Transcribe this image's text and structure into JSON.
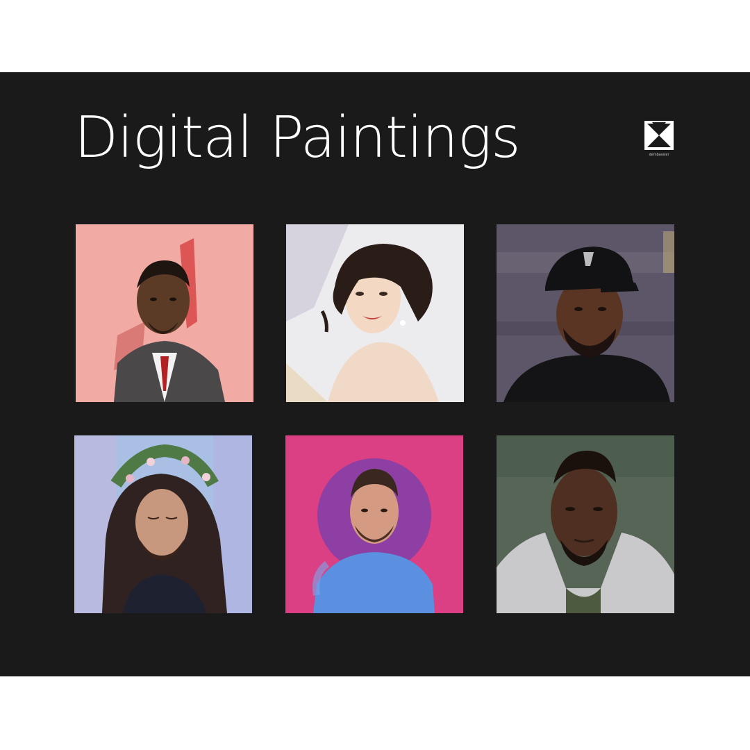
{
  "page": {
    "title": "Digital Paintings"
  },
  "brand": {
    "logo_caption": "dembassier"
  },
  "gallery": {
    "items": [
      {
        "name": "portrait-man-suit-pink",
        "background": "#f1aaa4"
      },
      {
        "name": "portrait-woman-white",
        "background": "#ecebed"
      },
      {
        "name": "portrait-man-cap-purple",
        "background": "#5d5668"
      },
      {
        "name": "portrait-man-flower-crown-blue",
        "background": "#a9bfe4"
      },
      {
        "name": "portrait-man-blue-shirt-magenta",
        "background": "#db3f84"
      },
      {
        "name": "portrait-man-hoodie-green",
        "background": "#566556"
      }
    ]
  },
  "colors": {
    "panel": "#1a1a1a",
    "title": "#ffffff"
  }
}
